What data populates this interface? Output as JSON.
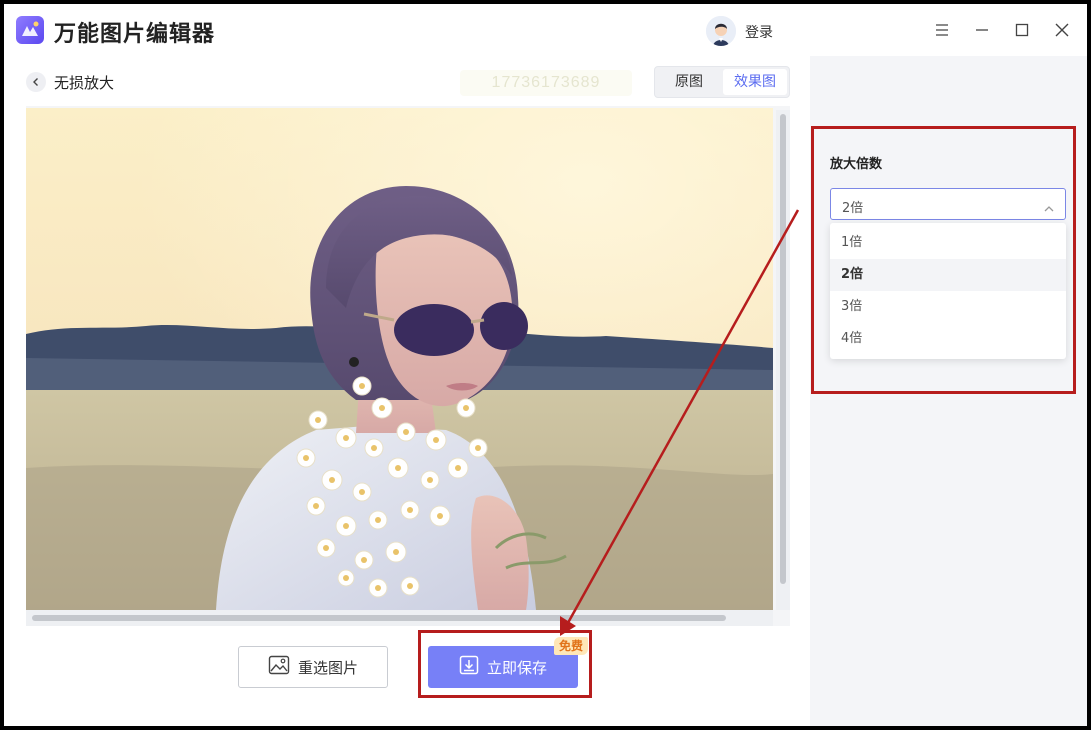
{
  "app": {
    "title": "万能图片编辑器",
    "login": "登录"
  },
  "subheader": {
    "title": "无损放大",
    "watermark": "17736173689",
    "toggle": [
      "原图",
      "效果图"
    ]
  },
  "actions": {
    "reselect": "重选图片",
    "save": "立即保存",
    "free_badge": "免费"
  },
  "panel": {
    "title": "放大倍数",
    "selected": "2倍",
    "options": [
      "1倍",
      "2倍",
      "3倍",
      "4倍"
    ],
    "selected_index": 1
  },
  "icons": [
    "app-logo-icon",
    "avatar-icon",
    "menu-icon",
    "minimize-icon",
    "maximize-icon",
    "close-icon",
    "back-arrow-icon",
    "image-icon",
    "download-icon",
    "chevron-up-icon"
  ],
  "colors": {
    "accent": "#7780f7",
    "annotation": "#b61d1d",
    "badge_bg": "#ffe7b8",
    "badge_text": "#e1731a"
  }
}
